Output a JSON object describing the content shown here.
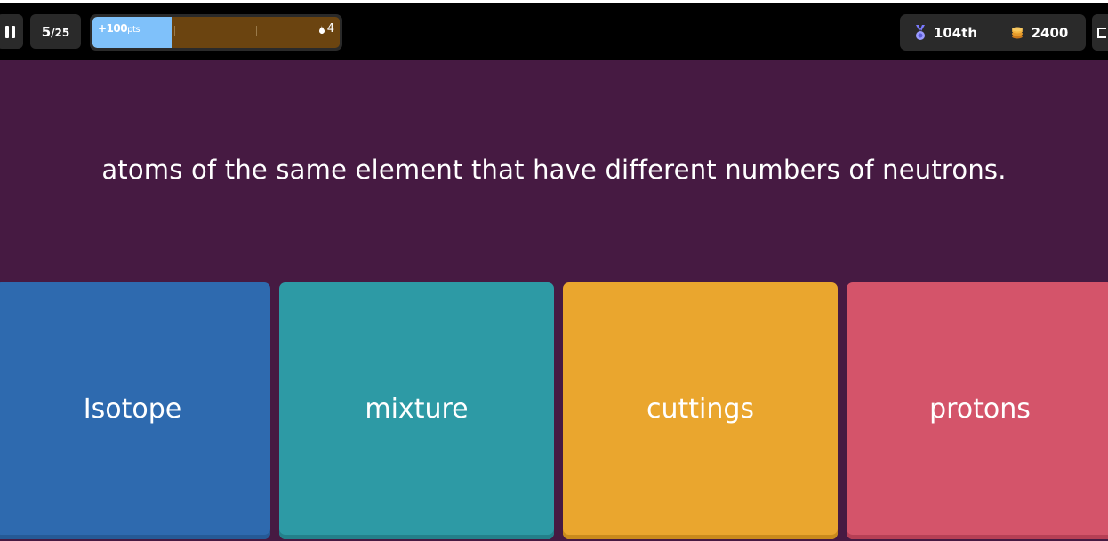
{
  "header": {
    "question_current": "5",
    "question_total": "/25",
    "streak_points": "+100",
    "streak_points_unit": "pts",
    "streak_progress": 0.32,
    "streak_count": "4",
    "rank": "104th",
    "coins": "2400"
  },
  "question": {
    "text": "atoms of the same element that have different numbers of neutrons."
  },
  "options": [
    {
      "label": "Isotope",
      "color": "#2e6aaf",
      "shadow": "#255a96"
    },
    {
      "label": "mixture",
      "color": "#2d9aa5",
      "shadow": "#23808a"
    },
    {
      "label": "cuttings",
      "color": "#eaa62e",
      "shadow": "#c98a1c"
    },
    {
      "label": "protons",
      "color": "#d4546a",
      "shadow": "#b63f55"
    }
  ],
  "colors": {
    "question_bg": "#461a42",
    "streak_track": "#6b4410",
    "streak_fill": "#7fc1fa"
  },
  "icons": {
    "pause": "pause-icon",
    "streak": "flame-icon",
    "rank": "medal-icon",
    "coins": "coins-icon",
    "fullscreen": "fullscreen-icon"
  }
}
